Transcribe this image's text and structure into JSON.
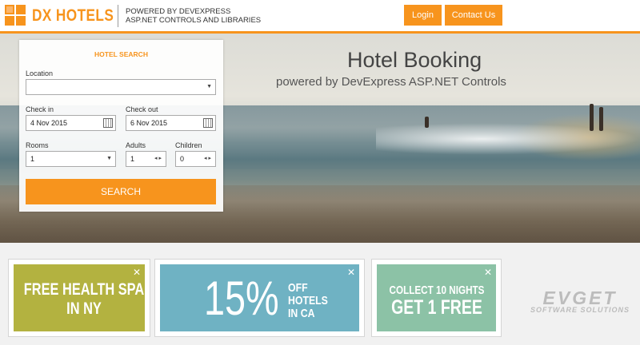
{
  "header": {
    "logo_text": "DX HOTELS",
    "tagline_line1": "POWERED BY DEVEXPRESS",
    "tagline_line2": "ASP.NET CONTROLS AND LIBRARIES",
    "login_label": "Login",
    "contact_label": "Contact Us",
    "accent_color": "#f7941d"
  },
  "hero": {
    "title": "Hotel Booking",
    "subtitle": "powered by DevExpress ASP.NET Controls"
  },
  "search": {
    "title": "HOTEL SEARCH",
    "location_label": "Location",
    "location_value": "",
    "checkin_label": "Check in",
    "checkin_value": "4 Nov 2015",
    "checkout_label": "Check out",
    "checkout_value": "6 Nov 2015",
    "rooms_label": "Rooms",
    "rooms_value": "1",
    "adults_label": "Adults",
    "adults_value": "1",
    "children_label": "Children",
    "children_value": "0",
    "search_button": "SEARCH"
  },
  "promos": [
    {
      "lines": [
        "FREE HEALTH SPA",
        "IN NY"
      ],
      "color": "#b3b240"
    },
    {
      "big": "15%",
      "lines": [
        "OFF",
        "HOTELS",
        "IN CA"
      ],
      "color": "#6fb2c3"
    },
    {
      "lines": [
        "COLLECT 10 NIGHTS",
        "GET 1 FREE"
      ],
      "color": "#8cc2a6"
    }
  ],
  "watermark": {
    "line1": "EVGET",
    "line2": "SOFTWARE SOLUTIONS"
  },
  "icons": [
    "hotel-logo-icon",
    "dropdown-arrow-icon",
    "calendar-icon",
    "spin-arrows-icon",
    "close-icon"
  ]
}
